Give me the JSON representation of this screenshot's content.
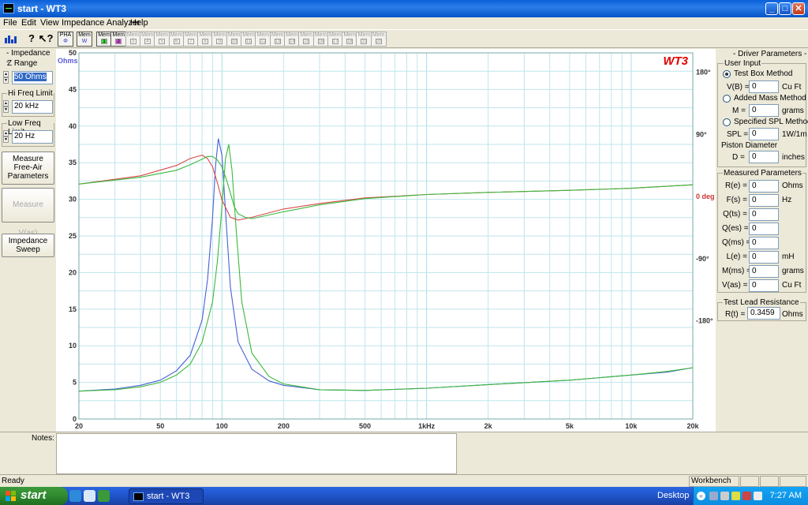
{
  "window": {
    "title": "start - WT3"
  },
  "menu": [
    "File",
    "Edit",
    "View",
    "Impedance Analyzer",
    "Help"
  ],
  "toolbar": {
    "pha_label": "PHA",
    "mem_w_label": "Mem",
    "mem_w_sub": "W",
    "mem_label": "Mem",
    "mem_numbers": [
      "1",
      "2",
      "3",
      "4",
      "5",
      "6",
      "7",
      "8",
      "9",
      "10",
      "11",
      "12",
      "13",
      "14",
      "15",
      "16",
      "17",
      "18",
      "19",
      "20"
    ]
  },
  "impedance_group": {
    "title": "- Impedance -",
    "z_range_label": "Z Range",
    "z_range_value": "50 Ohms",
    "hi_freq_label": "Hi Freq Limit",
    "hi_freq_value": "20 kHz",
    "low_freq_label": "Low Freq Limit",
    "low_freq_value": "20 Hz"
  },
  "buttons": {
    "measure_free_air": [
      "Measure",
      "Free-Air",
      "Parameters"
    ],
    "measure_vas": "Measure V(as)",
    "impedance_sweep": [
      "Impedance",
      "Sweep"
    ]
  },
  "chart_data": {
    "type": "line",
    "watermark": "WT3",
    "x_scale": "log",
    "xlim": [
      20,
      20000
    ],
    "x_ticks": [
      20,
      50,
      100,
      200,
      500,
      1000,
      2000,
      5000,
      10000,
      20000
    ],
    "x_tick_labels": [
      "20",
      "50",
      "100",
      "200",
      "500",
      "1kHz",
      "2k",
      "5k",
      "10k",
      "20k"
    ],
    "ylim": [
      0,
      50
    ],
    "y_ticks": [
      0,
      5,
      10,
      15,
      20,
      25,
      30,
      35,
      40,
      45,
      50
    ],
    "y_unit_label": "Ohms",
    "y2_ticks": [
      180,
      90,
      0,
      -90,
      -180
    ],
    "y2_tick_labels": [
      "180°",
      "90°",
      "0 deg",
      "-90°",
      "-180°"
    ],
    "y2lim": [
      -322,
      208
    ],
    "grid": true,
    "colors": {
      "grid": "#bfe6ec",
      "grid_major": "#a8dde4",
      "watermark": "#e00000",
      "ohms_label": "#5b5bd6",
      "deg_label": "#c33"
    },
    "series": [
      {
        "kind": "impedance",
        "axis": "y",
        "color": "#4a5fd6",
        "x": [
          20,
          30,
          40,
          50,
          60,
          70,
          80,
          85,
          90,
          93,
          96,
          100,
          104,
          110,
          120,
          140,
          170,
          200,
          300,
          500,
          1000,
          2000,
          5000,
          10000,
          15000,
          20000
        ],
        "y": [
          3.8,
          4.1,
          4.6,
          5.3,
          6.6,
          8.7,
          13.5,
          19.0,
          27.5,
          34.5,
          38.3,
          36.0,
          28.5,
          18.0,
          10.5,
          6.8,
          5.2,
          4.6,
          4.0,
          3.9,
          4.2,
          4.7,
          5.3,
          6.0,
          6.4,
          7.0
        ]
      },
      {
        "kind": "impedance",
        "axis": "y",
        "color": "#3cb83c",
        "x": [
          20,
          30,
          40,
          50,
          60,
          70,
          80,
          90,
          95,
          100,
          104,
          108,
          112,
          118,
          125,
          140,
          170,
          200,
          300,
          500,
          1000,
          2000,
          5000,
          10000,
          15000,
          20000
        ],
        "y": [
          3.8,
          4.0,
          4.4,
          5.0,
          6.0,
          7.5,
          10.5,
          16.0,
          21.5,
          29.0,
          35.5,
          37.5,
          34.0,
          25.0,
          16.0,
          9.0,
          5.8,
          4.8,
          4.0,
          3.9,
          4.2,
          4.7,
          5.3,
          6.0,
          6.5,
          7.0
        ]
      },
      {
        "kind": "phase",
        "axis": "y2",
        "color": "#d94a4a",
        "x": [
          20,
          40,
          60,
          70,
          80,
          85,
          90,
          95,
          100,
          110,
          120,
          140,
          200,
          300,
          500,
          1000,
          2000,
          5000,
          10000,
          20000
        ],
        "y": [
          18,
          30,
          45,
          55,
          60,
          55,
          43,
          20,
          -5,
          -30,
          -34,
          -30,
          -18,
          -10,
          -2,
          3,
          6,
          9,
          12,
          17
        ]
      },
      {
        "kind": "phase",
        "axis": "y2",
        "color": "#3cb83c",
        "x": [
          20,
          40,
          60,
          70,
          80,
          85,
          90,
          95,
          100,
          105,
          110,
          115,
          120,
          130,
          140,
          200,
          300,
          500,
          1000,
          2000,
          5000,
          10000,
          20000
        ],
        "y": [
          18,
          28,
          38,
          46,
          54,
          58,
          58,
          53,
          43,
          25,
          5,
          -15,
          -25,
          -30,
          -32,
          -22,
          -12,
          -3,
          3,
          6,
          9,
          12,
          17
        ]
      }
    ]
  },
  "driver_params": {
    "title": "- Driver Parameters -",
    "user_input_title": "User Input",
    "methods": [
      "Test Box Method",
      "Added Mass Method",
      "Specified SPL Method"
    ],
    "vb_label": "V(B) =",
    "vb_value": "0",
    "vb_unit": "Cu Ft",
    "m_label": "M =",
    "m_value": "0",
    "m_unit": "grams",
    "spl_label": "SPL =",
    "spl_value": "0",
    "spl_unit": "1W/1m",
    "piston_label": "Piston Diameter",
    "d_label": "D =",
    "d_value": "0",
    "d_unit": "inches"
  },
  "measured_params": {
    "title": "Measured Parameters",
    "rows": [
      {
        "label": "R(e) =",
        "value": "0",
        "unit": "Ohms"
      },
      {
        "label": "F(s) =",
        "value": "0",
        "unit": "Hz"
      },
      {
        "label": "Q(ts) =",
        "value": "0",
        "unit": ""
      },
      {
        "label": "Q(es) =",
        "value": "0",
        "unit": ""
      },
      {
        "label": "Q(ms) =",
        "value": "0",
        "unit": ""
      },
      {
        "label": "L(e) =",
        "value": "0",
        "unit": "mH"
      },
      {
        "label": "M(ms) =",
        "value": "0",
        "unit": "grams"
      },
      {
        "label": "V(as) =",
        "value": "0",
        "unit": "Cu Ft"
      }
    ]
  },
  "test_lead": {
    "title": "Test Lead Resistance",
    "label": "R(t) =",
    "value": "0.3459",
    "unit": "Ohms"
  },
  "notes_label": "Notes:",
  "status": {
    "text": "Ready",
    "workbench": "Workbench"
  },
  "taskbar": {
    "start": "start",
    "task_title": "start - WT3",
    "desktop": "Desktop",
    "clock": "7:27 AM"
  }
}
